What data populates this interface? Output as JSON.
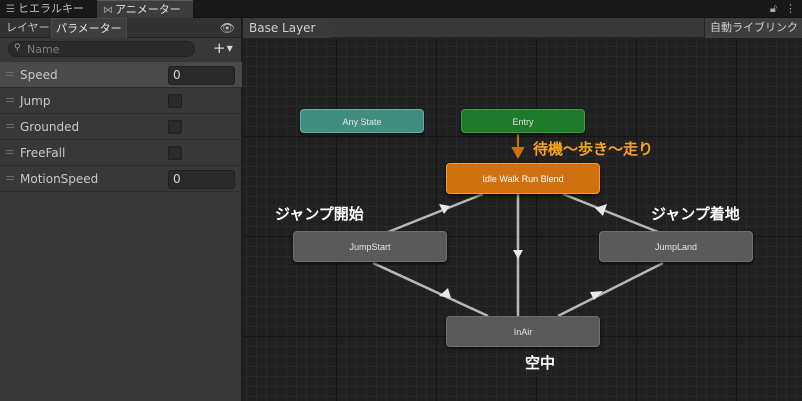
{
  "tabs": {
    "hierarchy_label": "ヒエラルキー",
    "animator_label": "アニメーター"
  },
  "left_panel": {
    "tab_layers": "レイヤー",
    "tab_parameters": "パラメーター",
    "search_placeholder": "Name",
    "add_label": "+",
    "parameters": [
      {
        "name": "Speed",
        "type": "float",
        "value": "0"
      },
      {
        "name": "Jump",
        "type": "bool"
      },
      {
        "name": "Grounded",
        "type": "bool"
      },
      {
        "name": "FreeFall",
        "type": "bool"
      },
      {
        "name": "MotionSpeed",
        "type": "float",
        "value": "0"
      }
    ]
  },
  "graph": {
    "breadcrumb": "Base Layer",
    "auto_live_link": "自動ライブリンク",
    "nodes": {
      "any_state": "Any State",
      "entry": "Entry",
      "idle_walk_run": "Idle Walk Run Blend",
      "jump_start": "JumpStart",
      "jump_land": "JumpLand",
      "in_air": "InAir"
    },
    "annotations": {
      "blend": "待機〜歩き〜走り",
      "jump_start": "ジャンプ開始",
      "jump_land": "ジャンプ着地",
      "in_air": "空中"
    }
  },
  "colors": {
    "any_state": "#3f8e80",
    "entry": "#1f7a2c",
    "default_state": "#d0700e",
    "state": "#5a5a5a",
    "annotation_orange": "#f5a31e"
  }
}
